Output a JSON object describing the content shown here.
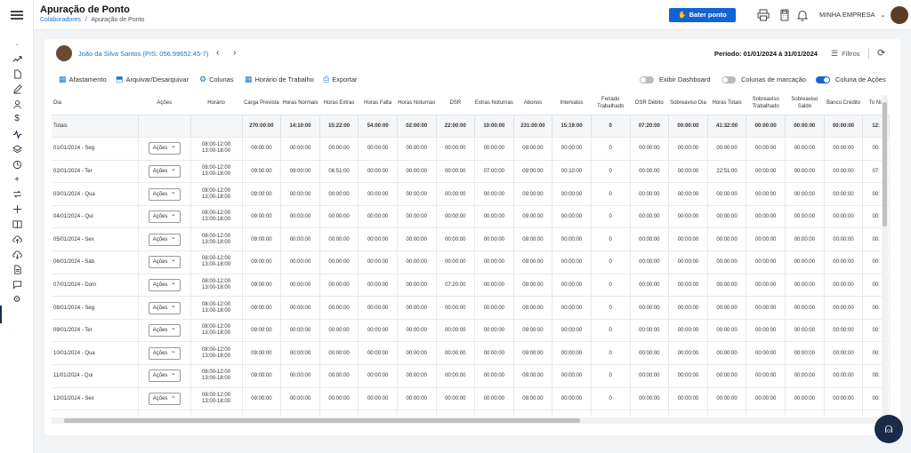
{
  "header": {
    "title": "Apuração de Ponto",
    "breadcrumb": {
      "parent": "Colaboradores",
      "separator": "/",
      "current": "Apuração de Ponto"
    },
    "bater_ponto": "Bater ponto",
    "company": "MINHA EMPRESA"
  },
  "employee": {
    "name": "João da Silva Santos (PIS: 056.99652.45-7)"
  },
  "periodo": "Período: 01/01/2024 à 31/01/2024",
  "filtros": "Filtros",
  "toolbar": {
    "afastamento": "Afastamento",
    "arquivar": "Arquivar/Desarquivar",
    "colunas": "Colunas",
    "horario": "Horário de Trabalho",
    "exportar": "Exportar"
  },
  "toggles": {
    "dashboard": "Exibir Dashboard",
    "marcacao": "Colunas de marcação",
    "acoes": "Coluna de Ações"
  },
  "table": {
    "headers": [
      "Dia",
      "Ações",
      "Horário",
      "Carga Prevista",
      "Horas Normais",
      "Horas Extras",
      "Horas Falta",
      "Horas Noturnas",
      "DSR",
      "Extras Noturnas",
      "Abonos",
      "Intervalos",
      "Feriado Trabalhado",
      "DSR Débito",
      "Sobreaviso Dia",
      "Horas Totais",
      "Sobreaviso Trabalhado",
      "Sobreaviso Saldo",
      "Banco Crédito",
      "To No"
    ],
    "totals_label": "Totais",
    "totals": [
      "270:00:00",
      "14:10:00",
      "15:22:00",
      "54:00:00",
      "02:00:00",
      "22:00:00",
      "10:00:00",
      "231:00:00",
      "15:19:00",
      "0",
      "07:20:00",
      "00:00:00",
      "41:32:00",
      "00:00:00",
      "00:00:00",
      "00:00:00",
      "12:"
    ],
    "acoes_label": "Ações",
    "rows": [
      {
        "dia": "01/01/2024 - Seg",
        "h1": "08:00-12:00",
        "h2": "13:00-18:00",
        "v": [
          "09:00:00",
          "00:00:00",
          "00:00:00",
          "00:00:00",
          "00:00:00",
          "00:00:00",
          "00:00:00",
          "09:00:00",
          "00:00:00",
          "0",
          "00:00:00",
          "00:00:00",
          "00:00:00",
          "00:00:00",
          "00:00:00",
          "00:00:00",
          "00:"
        ]
      },
      {
        "dia": "02/01/2024 - Ter",
        "h1": "08:00-12:00",
        "h2": "13:00-18:00",
        "v": [
          "09:00:00",
          "09:00:00",
          "06:51:00",
          "00:00:00",
          "00:00:00",
          "00:00:00",
          "07:00:00",
          "09:00:00",
          "00:10:00",
          "0",
          "00:00:00",
          "00:00:00",
          "22:51:00",
          "00:00:00",
          "00:00:00",
          "00:00:00",
          "07:"
        ]
      },
      {
        "dia": "03/01/2024 - Qua",
        "h1": "08:00-12:00",
        "h2": "13:00-18:00",
        "v": [
          "09:00:00",
          "00:00:00",
          "00:00:00",
          "00:00:00",
          "00:00:00",
          "00:00:00",
          "00:00:00",
          "09:00:00",
          "00:00:00",
          "0",
          "00:00:00",
          "00:00:00",
          "00:00:00",
          "00:00:00",
          "00:00:00",
          "00:00:00",
          "00:"
        ]
      },
      {
        "dia": "04/01/2024 - Qui",
        "h1": "08:00-12:00",
        "h2": "13:00-18:00",
        "v": [
          "09:00:00",
          "00:00:00",
          "00:00:00",
          "00:00:00",
          "00:00:00",
          "00:00:00",
          "00:00:00",
          "09:00:00",
          "00:00:00",
          "0",
          "00:00:00",
          "00:00:00",
          "00:00:00",
          "00:00:00",
          "00:00:00",
          "00:00:00",
          "00:"
        ]
      },
      {
        "dia": "05/01/2024 - Sex",
        "h1": "08:00-12:00",
        "h2": "13:00-18:00",
        "v": [
          "09:00:00",
          "00:00:00",
          "00:00:00",
          "00:00:00",
          "00:00:00",
          "00:00:00",
          "00:00:00",
          "09:00:00",
          "00:00:00",
          "0",
          "00:00:00",
          "00:00:00",
          "00:00:00",
          "00:00:00",
          "00:00:00",
          "00:00:00",
          "00:"
        ]
      },
      {
        "dia": "06/01/2024 - Sáb",
        "h1": "08:00-12:00",
        "h2": "13:00-18:00",
        "v": [
          "09:00:00",
          "00:00:00",
          "00:00:00",
          "00:00:00",
          "00:00:00",
          "00:00:00",
          "00:00:00",
          "09:00:00",
          "00:00:00",
          "0",
          "00:00:00",
          "00:00:00",
          "00:00:00",
          "00:00:00",
          "00:00:00",
          "00:00:00",
          "00:"
        ]
      },
      {
        "dia": "07/01/2024 - Dom",
        "h1": "08:00-12:00",
        "h2": "13:00-18:00",
        "v": [
          "09:00:00",
          "00:00:00",
          "00:00:00",
          "00:00:00",
          "00:00:00",
          "07:20:00",
          "00:00:00",
          "09:00:00",
          "00:00:00",
          "0",
          "00:00:00",
          "00:00:00",
          "00:00:00",
          "00:00:00",
          "00:00:00",
          "00:00:00",
          "00:"
        ]
      },
      {
        "dia": "08/01/2024 - Seg",
        "h1": "08:00-12:00",
        "h2": "13:00-18:00",
        "v": [
          "09:00:00",
          "00:00:00",
          "00:00:00",
          "00:00:00",
          "00:00:00",
          "00:00:00",
          "00:00:00",
          "09:00:00",
          "00:00:00",
          "0",
          "00:00:00",
          "00:00:00",
          "00:00:00",
          "00:00:00",
          "00:00:00",
          "00:00:00",
          "00:"
        ]
      },
      {
        "dia": "09/01/2024 - Ter",
        "h1": "08:00-12:00",
        "h2": "13:00-18:00",
        "v": [
          "09:00:00",
          "00:00:00",
          "00:00:00",
          "00:00:00",
          "00:00:00",
          "00:00:00",
          "00:00:00",
          "09:00:00",
          "00:00:00",
          "0",
          "00:00:00",
          "00:00:00",
          "00:00:00",
          "00:00:00",
          "00:00:00",
          "00:00:00",
          "00:"
        ]
      },
      {
        "dia": "10/01/2024 - Qua",
        "h1": "08:00-12:00",
        "h2": "13:00-18:00",
        "v": [
          "09:00:00",
          "00:00:00",
          "00:00:00",
          "00:00:00",
          "00:00:00",
          "00:00:00",
          "00:00:00",
          "09:00:00",
          "00:00:00",
          "0",
          "00:00:00",
          "00:00:00",
          "00:00:00",
          "00:00:00",
          "00:00:00",
          "00:00:00",
          "00:"
        ]
      },
      {
        "dia": "11/01/2024 - Qui",
        "h1": "08:00-12:00",
        "h2": "13:00-18:00",
        "v": [
          "09:00:00",
          "00:00:00",
          "00:00:00",
          "00:00:00",
          "00:00:00",
          "00:00:00",
          "00:00:00",
          "09:00:00",
          "00:00:00",
          "0",
          "00:00:00",
          "00:00:00",
          "00:00:00",
          "00:00:00",
          "00:00:00",
          "00:00:00",
          "00:"
        ]
      },
      {
        "dia": "12/01/2024 - Sex",
        "h1": "08:00-12:00",
        "h2": "13:00-18:00",
        "v": [
          "09:00:00",
          "00:00:00",
          "00:00:00",
          "00:00:00",
          "00:00:00",
          "00:00:00",
          "00:00:00",
          "09:00:00",
          "00:00:00",
          "0",
          "00:00:00",
          "00:00:00",
          "00:00:00",
          "00:00:00",
          "00:00:00",
          "00:00:00",
          "00:"
        ]
      },
      {
        "dia": "",
        "h1": "08:00-12:00",
        "h2": "",
        "v": [
          "",
          "",
          "",
          "",
          "",
          "",
          "",
          "",
          "",
          "",
          "",
          "",
          "",
          "",
          "",
          "",
          ""
        ]
      }
    ]
  },
  "colors": {
    "accent": "#1264d6",
    "link": "#1a73c9",
    "sidebar_dark": "#1a2b4a"
  }
}
